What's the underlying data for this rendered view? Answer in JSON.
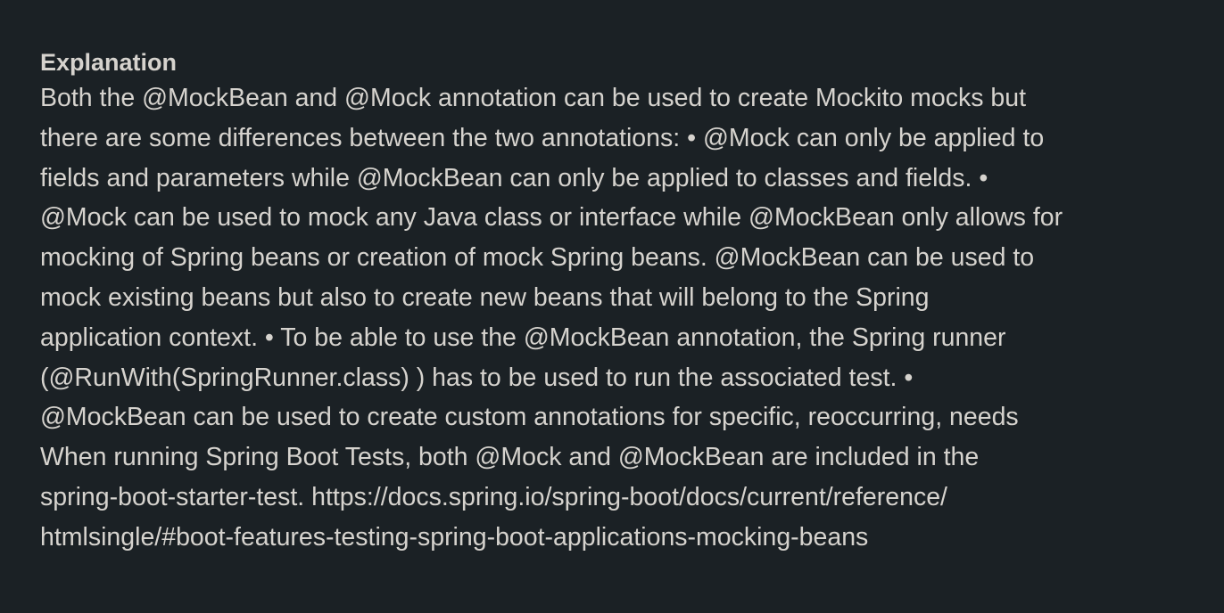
{
  "explanation": {
    "heading": "Explanation",
    "lines": [
      "Both the @MockBean and @Mock annotation can be used to create Mockito mocks but",
      "there are some differences between the two annotations: • @Mock can only be applied to",
      "fields and parameters while @MockBean can only be applied to classes and fields. •",
      "@Mock can be used to mock any Java class or interface while @MockBean only allows for",
      "mocking of Spring beans or creation of mock Spring beans. @MockBean can be used to",
      "mock existing beans but also to create new beans that will belong to the Spring",
      "application context. • To be able to use the @MockBean annotation, the Spring runner",
      "(@RunWith(SpringRunner.class) ) has to be used to run the associated test. •",
      "@MockBean can be used to create custom annotations for specific, reoccurring, needs",
      "When running Spring Boot Tests, both @Mock and @MockBean are included in the",
      "spring-boot-starter-test. https://docs.spring.io/spring-boot/docs/current/reference/",
      "htmlsingle/#boot-features-testing-spring-boot-applications-mocking-beans"
    ]
  },
  "colors": {
    "background": "#1b2125",
    "text": "#d6d3ce"
  }
}
